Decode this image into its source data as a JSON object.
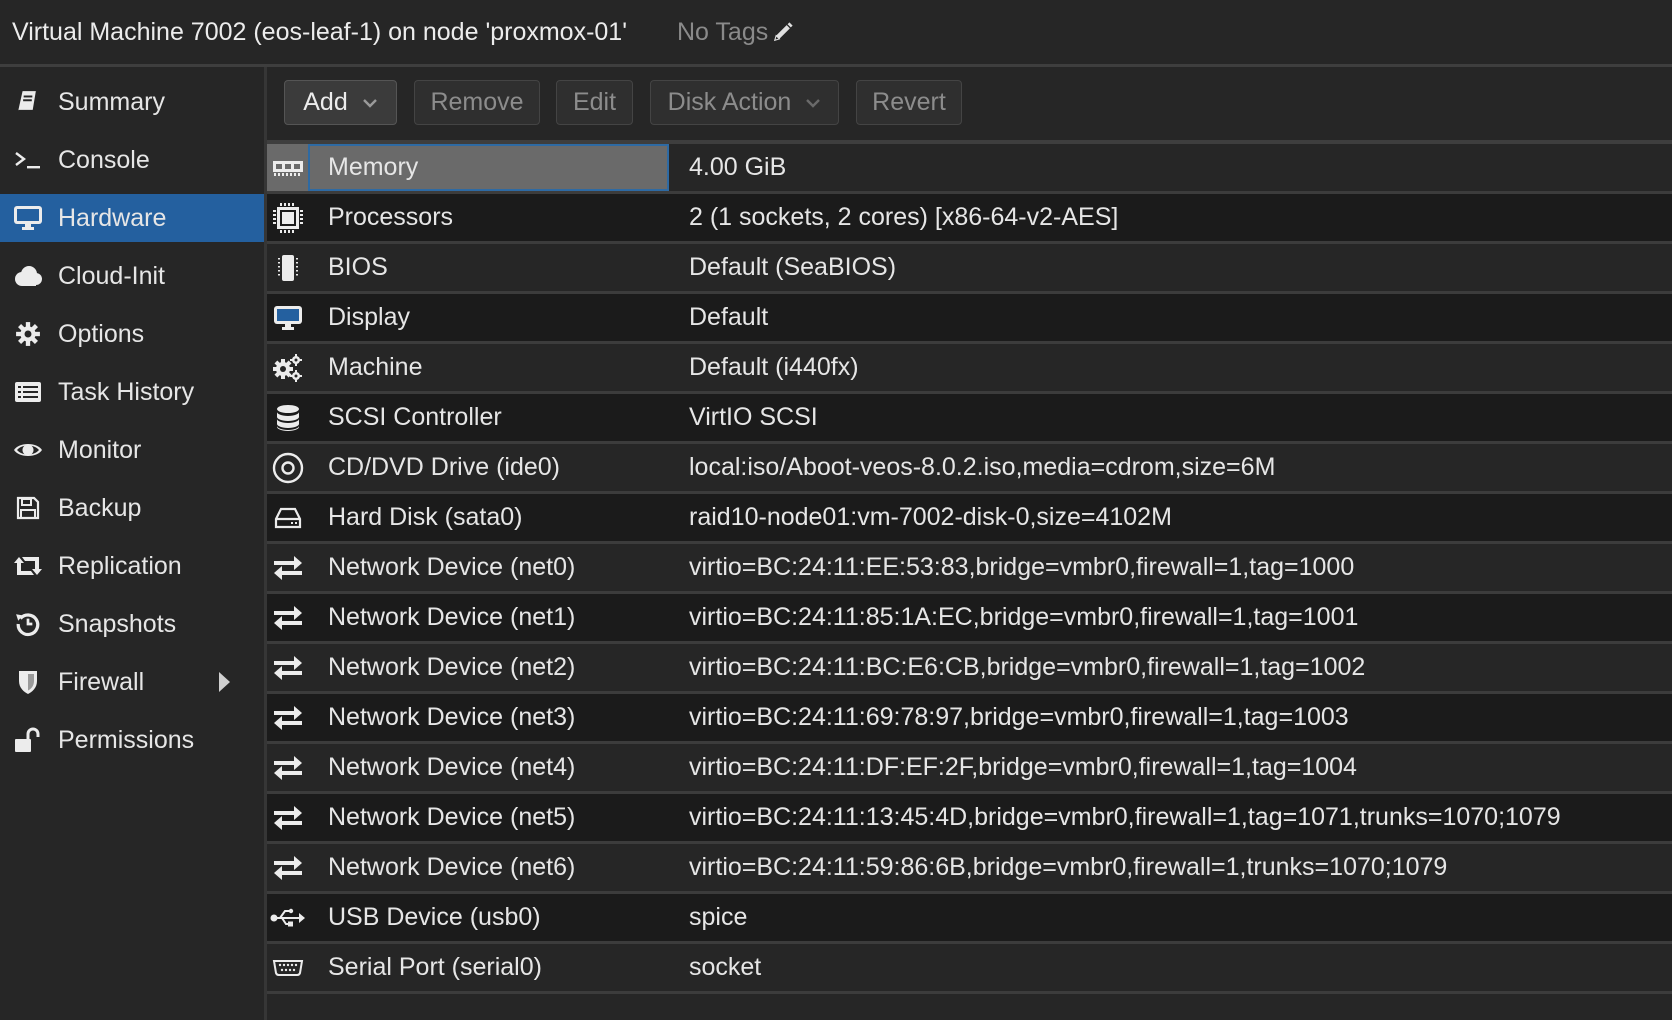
{
  "header": {
    "title": "Virtual Machine 7002 (eos-leaf-1) on node 'proxmox-01'",
    "tags_label": "No Tags",
    "tags_icon": "pencil-icon"
  },
  "sidebar": {
    "items": [
      {
        "label": "Summary",
        "icon": "book-icon",
        "active": false
      },
      {
        "label": "Console",
        "icon": "terminal-icon",
        "active": false
      },
      {
        "label": "Hardware",
        "icon": "desktop-icon",
        "active": true
      },
      {
        "label": "Cloud-Init",
        "icon": "cloud-icon",
        "active": false
      },
      {
        "label": "Options",
        "icon": "gear-icon",
        "active": false
      },
      {
        "label": "Task History",
        "icon": "list-alt-icon",
        "active": false
      },
      {
        "label": "Monitor",
        "icon": "eye-icon",
        "active": false
      },
      {
        "label": "Backup",
        "icon": "floppy-icon",
        "active": false
      },
      {
        "label": "Replication",
        "icon": "retweet-icon",
        "active": false
      },
      {
        "label": "Snapshots",
        "icon": "history-icon",
        "active": false
      },
      {
        "label": "Firewall",
        "icon": "shield-icon",
        "active": false,
        "expandable": true
      },
      {
        "label": "Permissions",
        "icon": "unlock-icon",
        "active": false
      }
    ]
  },
  "toolbar": {
    "add_label": "Add",
    "remove_label": "Remove",
    "edit_label": "Edit",
    "disk_action_label": "Disk Action",
    "revert_label": "Revert"
  },
  "hardware": {
    "selected_index": 0,
    "rows": [
      {
        "name": "Memory",
        "value": "4.00 GiB",
        "icon": "memory-icon"
      },
      {
        "name": "Processors",
        "value": "2 (1 sockets, 2 cores) [x86-64-v2-AES]",
        "icon": "cpu-icon"
      },
      {
        "name": "BIOS",
        "value": "Default (SeaBIOS)",
        "icon": "microchip-icon"
      },
      {
        "name": "Display",
        "value": "Default",
        "icon": "desktop-icon"
      },
      {
        "name": "Machine",
        "value": "Default (i440fx)",
        "icon": "cogs-icon"
      },
      {
        "name": "SCSI Controller",
        "value": "VirtIO SCSI",
        "icon": "database-icon"
      },
      {
        "name": "CD/DVD Drive (ide0)",
        "value": "local:iso/Aboot-veos-8.0.2.iso,media=cdrom,size=6M",
        "icon": "cdrom-icon"
      },
      {
        "name": "Hard Disk (sata0)",
        "value": "raid10-node01:vm-7002-disk-0,size=4102M",
        "icon": "hdd-icon"
      },
      {
        "name": "Network Device (net0)",
        "value": "virtio=BC:24:11:EE:53:83,bridge=vmbr0,firewall=1,tag=1000",
        "icon": "exchange-icon"
      },
      {
        "name": "Network Device (net1)",
        "value": "virtio=BC:24:11:85:1A:EC,bridge=vmbr0,firewall=1,tag=1001",
        "icon": "exchange-icon"
      },
      {
        "name": "Network Device (net2)",
        "value": "virtio=BC:24:11:BC:E6:CB,bridge=vmbr0,firewall=1,tag=1002",
        "icon": "exchange-icon"
      },
      {
        "name": "Network Device (net3)",
        "value": "virtio=BC:24:11:69:78:97,bridge=vmbr0,firewall=1,tag=1003",
        "icon": "exchange-icon"
      },
      {
        "name": "Network Device (net4)",
        "value": "virtio=BC:24:11:DF:EF:2F,bridge=vmbr0,firewall=1,tag=1004",
        "icon": "exchange-icon"
      },
      {
        "name": "Network Device (net5)",
        "value": "virtio=BC:24:11:13:45:4D,bridge=vmbr0,firewall=1,tag=1071,trunks=1070;1079",
        "icon": "exchange-icon"
      },
      {
        "name": "Network Device (net6)",
        "value": "virtio=BC:24:11:59:86:6B,bridge=vmbr0,firewall=1,trunks=1070;1079",
        "icon": "exchange-icon"
      },
      {
        "name": "USB Device (usb0)",
        "value": "spice",
        "icon": "usb-icon"
      },
      {
        "name": "Serial Port (serial0)",
        "value": "socket",
        "icon": "serial-port-icon"
      }
    ]
  },
  "colors": {
    "accent": "#24609f",
    "selected_row": "#6a6a6a",
    "focus_border": "#2e6aa3"
  }
}
